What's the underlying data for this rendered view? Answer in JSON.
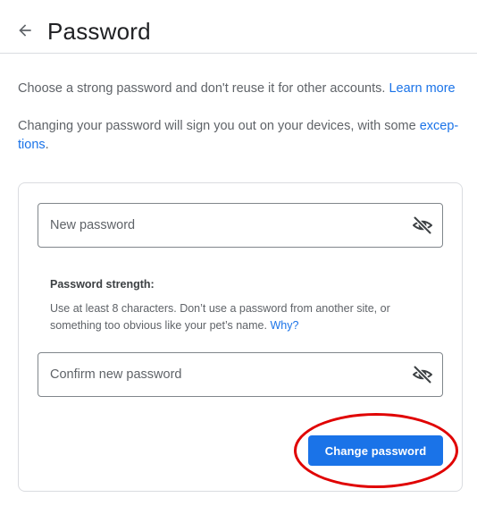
{
  "header": {
    "back_icon": "arrow-back-icon",
    "title": "Password"
  },
  "intro": {
    "line1": "Choose a strong password and don't reuse it for other accounts.",
    "learn_more": "Learn more",
    "line2_prefix": "Changing your password will sign you out on your devices, with some ",
    "exceptions_part1": "excep-",
    "exceptions_part2": "tions",
    "line2_suffix": "."
  },
  "form": {
    "new_password": {
      "placeholder": "New password",
      "value": "",
      "toggle_icon": "eye-off-icon"
    },
    "strength": {
      "title": "Password strength:",
      "hint": "Use at least 8 characters. Don’t use a password from another site, or something too obvious like your pet’s name.",
      "why_link": "Why?"
    },
    "confirm_password": {
      "placeholder": "Confirm new password",
      "value": "",
      "toggle_icon": "eye-off-icon"
    },
    "submit_label": "Change password"
  },
  "annotation": {
    "highlight_color": "#e00000",
    "highlight_target": "change-password-button"
  },
  "colors": {
    "accent": "#1a73e8",
    "border": "#dadce0",
    "field_border": "#80868b",
    "text": "#3c4043",
    "muted_text": "#5f6368"
  }
}
